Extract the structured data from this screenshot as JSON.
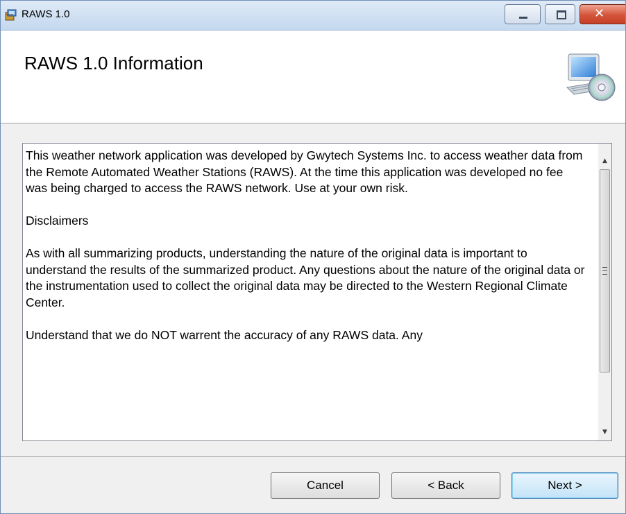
{
  "window": {
    "title": "RAWS 1.0",
    "buttons": {
      "minimize": "minimize-icon",
      "maximize": "maximize-icon",
      "close": "close-icon"
    }
  },
  "header": {
    "title": "RAWS 1.0 Information",
    "icon": "computer-cd-icon"
  },
  "info_text": {
    "paragraphs": [
      "This weather network application was developed by Gwytech Systems Inc. to access weather data from the Remote Automated Weather Stations (RAWS). At the time this application was developed no fee was being charged to access the RAWS network. Use at your own risk.",
      "Disclaimers",
      "As with all summarizing products, understanding the nature of the original data is important to understand the results of the summarized product. Any questions about the nature of the original data or the instrumentation used to collect the original data may be directed to the Western Regional Climate Center.",
      "Understand that we do NOT warrent the accuracy of any RAWS data. Any"
    ]
  },
  "footer": {
    "cancel_label": "Cancel",
    "back_label": "< Back",
    "next_label": "Next >"
  },
  "colors": {
    "accent": "#3c7fb1",
    "close": "#c63f27"
  }
}
